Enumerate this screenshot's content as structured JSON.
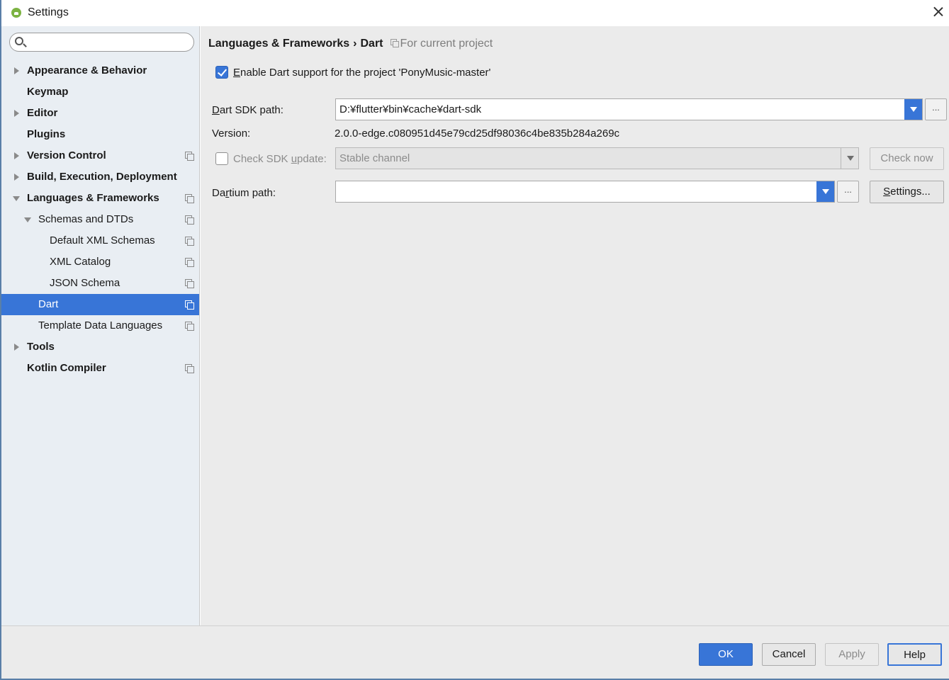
{
  "window": {
    "title": "Settings"
  },
  "sidebar": {
    "search": {
      "placeholder": "",
      "value": ""
    },
    "items": [
      {
        "label": "Appearance & Behavior",
        "bold": true,
        "expander": "collapsed",
        "indent": 0,
        "scoped": false
      },
      {
        "label": "Keymap",
        "bold": true,
        "expander": "none",
        "indent": 0,
        "scoped": false
      },
      {
        "label": "Editor",
        "bold": true,
        "expander": "collapsed",
        "indent": 0,
        "scoped": false
      },
      {
        "label": "Plugins",
        "bold": true,
        "expander": "none",
        "indent": 0,
        "scoped": false
      },
      {
        "label": "Version Control",
        "bold": true,
        "expander": "collapsed",
        "indent": 0,
        "scoped": true
      },
      {
        "label": "Build, Execution, Deployment",
        "bold": true,
        "expander": "collapsed",
        "indent": 0,
        "scoped": false
      },
      {
        "label": "Languages & Frameworks",
        "bold": true,
        "expander": "expanded",
        "indent": 0,
        "scoped": true
      },
      {
        "label": "Schemas and DTDs",
        "bold": false,
        "expander": "expanded",
        "indent": 1,
        "scoped": true
      },
      {
        "label": "Default XML Schemas",
        "bold": false,
        "expander": "none",
        "indent": 2,
        "scoped": true
      },
      {
        "label": "XML Catalog",
        "bold": false,
        "expander": "none",
        "indent": 2,
        "scoped": true
      },
      {
        "label": "JSON Schema",
        "bold": false,
        "expander": "none",
        "indent": 2,
        "scoped": true
      },
      {
        "label": "Dart",
        "bold": false,
        "expander": "none",
        "indent": 1,
        "scoped": true,
        "selected": true
      },
      {
        "label": "Template Data Languages",
        "bold": false,
        "expander": "none",
        "indent": 1,
        "scoped": true
      },
      {
        "label": "Tools",
        "bold": true,
        "expander": "collapsed",
        "indent": 0,
        "scoped": false
      },
      {
        "label": "Kotlin Compiler",
        "bold": true,
        "expander": "none",
        "indent": 0,
        "scoped": true
      }
    ]
  },
  "breadcrumb": {
    "parent": "Languages & Frameworks",
    "separator": "›",
    "current": "Dart",
    "scope": "For current project"
  },
  "dart": {
    "enable": {
      "checked": true,
      "label_mnemonic": "E",
      "label_rest": "nable Dart support for the project 'PonyMusic-master'"
    },
    "sdk_path": {
      "label_mnemonic": "D",
      "label_rest": "art SDK path:",
      "value": "D:¥flutter¥bin¥cache¥dart-sdk"
    },
    "version": {
      "label": "Version:",
      "value": "2.0.0-edge.c080951d45e79cd25df98036c4be835b284a269c"
    },
    "check_update": {
      "checked": false,
      "label_pre": "Check SDK ",
      "label_mnemonic": "u",
      "label_post": "pdate:",
      "channel": "Stable channel",
      "check_now": "Check now"
    },
    "dartium": {
      "label_pre": "Da",
      "label_mnemonic": "r",
      "label_post": "tium path:",
      "value": "",
      "settings_mnemonic": "S",
      "settings_rest": "ettings..."
    },
    "browse_label": "..."
  },
  "footer": {
    "ok": "OK",
    "cancel": "Cancel",
    "apply": "Apply",
    "help": "Help"
  },
  "colors": {
    "accent": "#3875d7",
    "sidebar_bg": "#e9eef3",
    "content_bg": "#ebebeb"
  }
}
